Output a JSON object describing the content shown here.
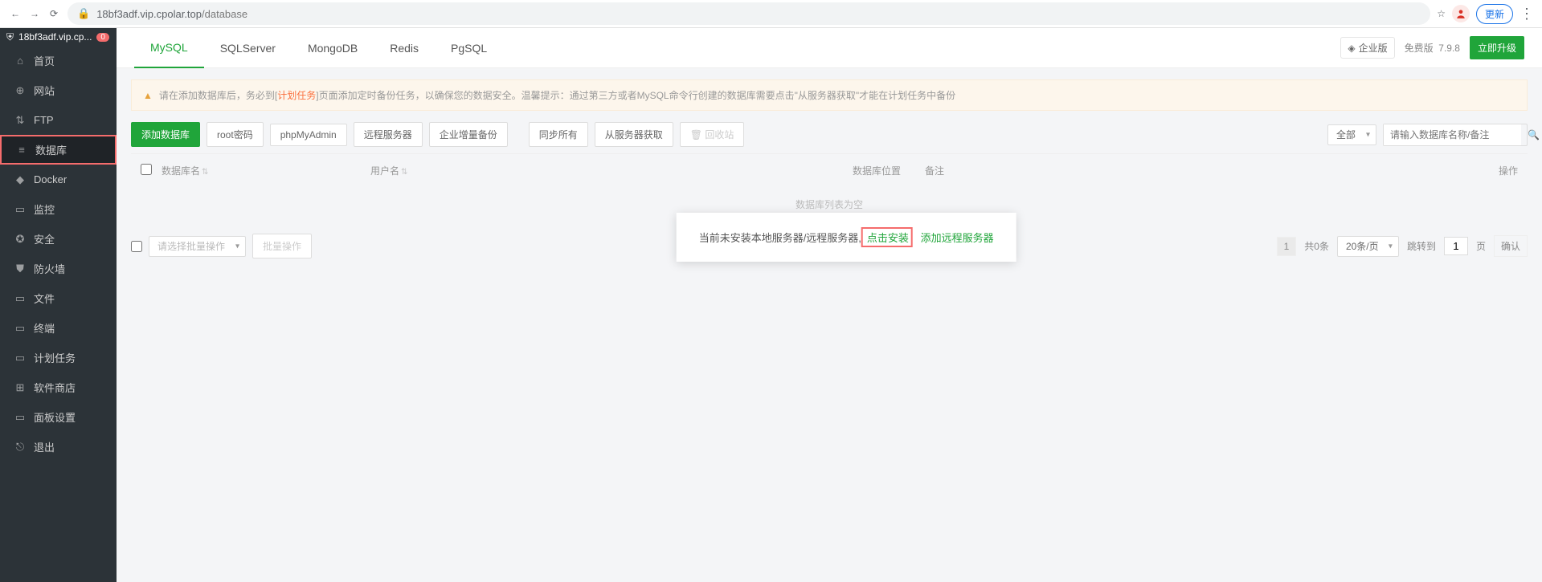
{
  "browser": {
    "url_host": "18bf3adf.vip.cpolar.top",
    "url_path": "/database",
    "update_label": "更新"
  },
  "sidebar": {
    "host": "18bf3adf.vip.cp...",
    "badge": "0",
    "items": [
      {
        "icon": "home",
        "label": "首页"
      },
      {
        "icon": "globe",
        "label": "网站"
      },
      {
        "icon": "ftp",
        "label": "FTP"
      },
      {
        "icon": "db",
        "label": "数据库"
      },
      {
        "icon": "docker",
        "label": "Docker"
      },
      {
        "icon": "monitor",
        "label": "监控"
      },
      {
        "icon": "security",
        "label": "安全"
      },
      {
        "icon": "firewall",
        "label": "防火墙"
      },
      {
        "icon": "file",
        "label": "文件"
      },
      {
        "icon": "terminal",
        "label": "终端"
      },
      {
        "icon": "cron",
        "label": "计划任务"
      },
      {
        "icon": "store",
        "label": "软件商店"
      },
      {
        "icon": "panel",
        "label": "面板设置"
      },
      {
        "icon": "logout",
        "label": "退出"
      }
    ]
  },
  "tabs": [
    "MySQL",
    "SQLServer",
    "MongoDB",
    "Redis",
    "PgSQL"
  ],
  "tabbar_right": {
    "ent": "企业版",
    "free": "免费版",
    "version": "7.9.8",
    "upgrade": "立即升级"
  },
  "alert": {
    "pre": "请在添加数据库后，务必到[",
    "link": "计划任务",
    "post": "]页面添加定时备份任务，以确保您的数据安全。温馨提示：通过第三方或者MySQL命令行创建的数据库需要点击\"从服务器获取\"才能在计划任务中备份"
  },
  "toolbar": {
    "add": "添加数据库",
    "root": "root密码",
    "pma": "phpMyAdmin",
    "remote": "远程服务器",
    "backup": "企业增量备份",
    "sync": "同步所有",
    "fetch": "从服务器获取",
    "recycle": "回收站",
    "filter_all": "全部",
    "search_ph": "请输入数据库名称/备注"
  },
  "table": {
    "cols": {
      "name": "数据库名",
      "user": "用户名",
      "loc": "数据库位置",
      "note": "备注",
      "op": "操作"
    },
    "empty": "数据库列表为空"
  },
  "popup": {
    "text": "当前未安装本地服务器/远程服务器,",
    "install": "点击安装",
    "or": " ",
    "add_remote": "添加远程服务器"
  },
  "footer": {
    "batch_ph": "请选择批量操作",
    "batch_btn": "批量操作",
    "page_cur": "1",
    "total": "共0条",
    "per_page": "20条/页",
    "jump": "跳转到",
    "page_input": "1",
    "page_suffix": "页",
    "confirm": "确认"
  }
}
